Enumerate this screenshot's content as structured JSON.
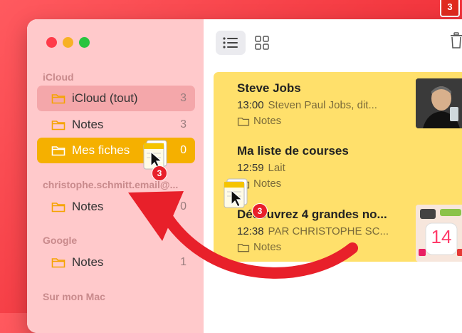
{
  "corner_badge": "3",
  "sidebar": {
    "sections": [
      {
        "title": "iCloud"
      },
      {
        "title": "christophe.schmitt.email@..."
      },
      {
        "title": "Google"
      },
      {
        "title": "Sur mon Mac"
      }
    ],
    "items": [
      {
        "label": "iCloud (tout)",
        "count": "3",
        "state": "muted"
      },
      {
        "label": "Notes",
        "count": "3",
        "state": "normal"
      },
      {
        "label": "Mes fiches",
        "count": "0",
        "state": "selected"
      },
      {
        "label": "Notes",
        "count": "0",
        "state": "normal"
      },
      {
        "label": "Notes",
        "count": "1",
        "state": "normal"
      }
    ]
  },
  "toolbar": {
    "list_view_icon": "list-icon",
    "gallery_view_icon": "grid-icon",
    "delete_icon": "trash-icon"
  },
  "notes": [
    {
      "title": "Steve Jobs",
      "time": "13:00",
      "preview": "Steven Paul Jobs, dit...",
      "folder": "Notes",
      "thumb": "portrait-photo"
    },
    {
      "title": "Ma liste de courses",
      "time": "12:59",
      "preview": "Lait",
      "folder": "Notes",
      "thumb": ""
    },
    {
      "title": "Découvrez 4 grandes no...",
      "time": "12:38",
      "preview": "PAR CHRISTOPHE SC...",
      "folder": "Notes",
      "thumb": "ios14-screenshot"
    }
  ],
  "drag": {
    "badge_count": "3"
  },
  "thumb_ios_label": "14",
  "colors": {
    "accent": "#f5b000",
    "sidebar_bg": "#ffc9cb",
    "notes_bg": "#ffe06b",
    "arrow": "#e8202a"
  }
}
